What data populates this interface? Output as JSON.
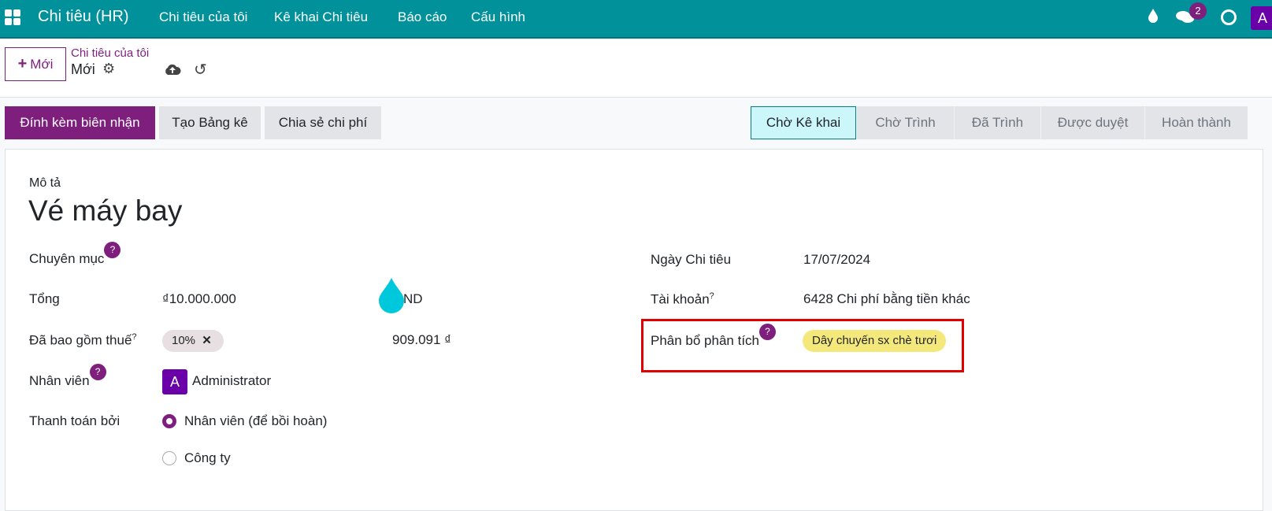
{
  "navbar": {
    "app_title": "Chi tiêu (HR)",
    "menu": [
      "Chi tiêu của tôi",
      "Kê khai Chi tiêu",
      "Báo cáo",
      "Cấu hình"
    ],
    "message_count": "2",
    "avatar_letter": "A",
    "colors": {
      "bar": "#00919b",
      "accent": "#7e1f7e"
    }
  },
  "control": {
    "new_label": "Mới",
    "breadcrumb_parent": "Chi tiêu của tôi",
    "breadcrumb_current": "Mới"
  },
  "actions": [
    "Đính kèm biên nhận",
    "Tạo Bảng kê",
    "Chia sẻ chi phí"
  ],
  "statusbar": {
    "stages": [
      "Chờ Kê khai",
      "Chờ Trình",
      "Đã Trình",
      "Được duyệt",
      "Hoàn thành"
    ],
    "active": "Chờ Kê khai"
  },
  "form": {
    "description_label": "Mô tả",
    "description": "Vé máy bay",
    "category_label": "Chuyên mục",
    "total_label": "Tổng",
    "total_value": "₫10.000.000",
    "currency": "ND",
    "tax_label": "Đã bao gồm thuế",
    "tax_tag": "10%",
    "tax_amount": "909.091 ₫",
    "employee_label": "Nhân viên",
    "employee_avatar": "A",
    "employee": "Administrator",
    "paid_by_label": "Thanh toán bởi",
    "paid_by_options": [
      "Nhân viên (để bồi hoàn)",
      "Công ty"
    ],
    "paid_by_selected": "Nhân viên (để bồi hoàn)",
    "date_label": "Ngày Chi tiêu",
    "date_value": "17/07/2024",
    "account_label": "Tài khoản",
    "account_value": "6428 Chi phí bằng tiền khác",
    "analytic_label": "Phân bổ phân tích",
    "analytic_tag": "Dây chuyến sx chè tươi"
  }
}
